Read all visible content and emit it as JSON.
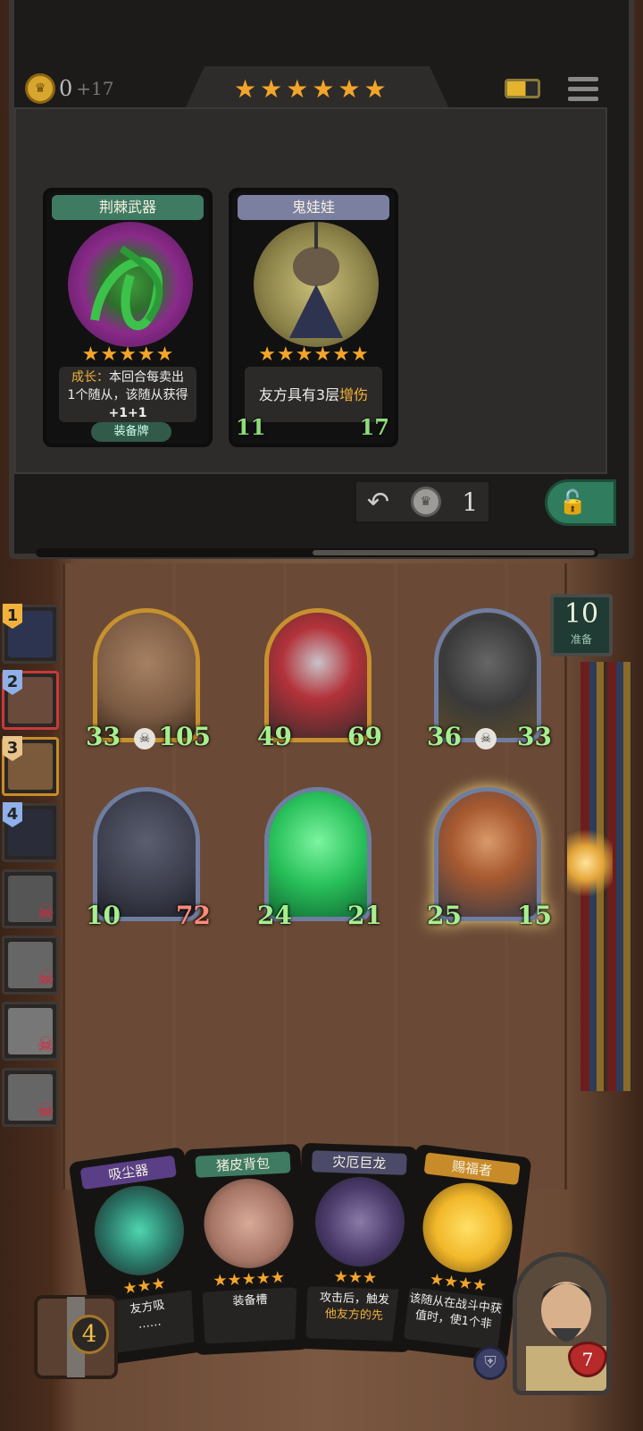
{
  "header": {
    "gold": "0",
    "gold_income": "+17",
    "tavern_stars": 6
  },
  "shop": {
    "cards": [
      {
        "name": "荆棘武器",
        "stars": 5,
        "desc_keyword": "成长：",
        "desc_line1": "本回合每卖出",
        "desc_line2": "1个随从，该随从获得",
        "desc_line3": "+1+1",
        "tag": "装备牌",
        "header_color": "#3f7a62"
      },
      {
        "name": "鬼娃娃",
        "stars": 6,
        "desc_main": "友方具有3层",
        "desc_keyword": "增伤",
        "attack": "11",
        "health": "17",
        "header_color": "#7b7fa0"
      }
    ],
    "refresh_cost": "1"
  },
  "ready": {
    "count": "10",
    "label": "准备"
  },
  "board": {
    "minions": [
      {
        "name": "tree-minion",
        "attack": "33",
        "health": "105",
        "frame": "gold",
        "skull": true
      },
      {
        "name": "vampire-minion",
        "attack": "49",
        "health": "69",
        "frame": "gold",
        "skull": false
      },
      {
        "name": "robot-minion",
        "attack": "36",
        "health": "33",
        "frame": "silver",
        "skull": true
      },
      {
        "name": "gargoyle-minion",
        "attack": "10",
        "health": "72",
        "frame": "silver",
        "skull": false,
        "health_color": "red"
      },
      {
        "name": "ghost-minion",
        "attack": "24",
        "health": "21",
        "frame": "silver",
        "skull": false
      },
      {
        "name": "archer-minion",
        "attack": "25",
        "health": "15",
        "frame": "silver",
        "skull": false
      }
    ]
  },
  "queue": {
    "items": [
      {
        "rank": "1",
        "dead": false
      },
      {
        "rank": "2",
        "dead": false
      },
      {
        "rank": "3",
        "dead": false
      },
      {
        "rank": "4",
        "dead": false
      },
      {
        "rank": "",
        "dead": true
      },
      {
        "rank": "",
        "dead": true
      },
      {
        "rank": "",
        "dead": true
      },
      {
        "rank": "",
        "dead": true
      }
    ]
  },
  "hand": {
    "cards": [
      {
        "name": "吸尘器",
        "desc": "友方吸",
        "desc2": "……",
        "stars": 3,
        "header_color": "#5a3f86"
      },
      {
        "name": "猪皮背包",
        "desc": "装备槽",
        "stars": 5,
        "header_color": "#3f7a62"
      },
      {
        "name": "灾厄巨龙",
        "desc": "攻击后，触发",
        "desc2": "他友方的先",
        "stars": 3,
        "header_color": "#4b4a68"
      },
      {
        "name": "赐福者",
        "desc": "该随从在战斗中获",
        "desc2": "值时，使1个非",
        "stars": 4,
        "header_color": "#c88b2a"
      }
    ]
  },
  "footer": {
    "deck_count": "4",
    "hero_health": "7"
  }
}
